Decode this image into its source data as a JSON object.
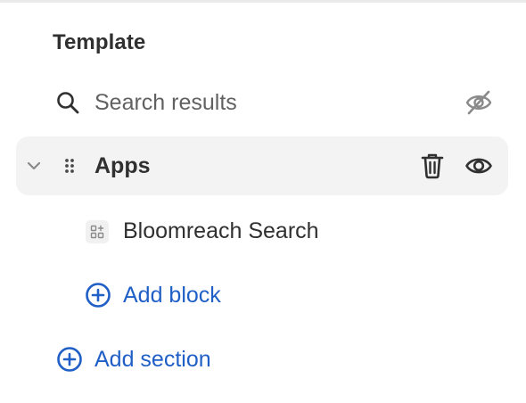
{
  "panel": {
    "heading": "Template",
    "rows": {
      "search": {
        "label": "Search results",
        "hidden": true
      },
      "apps": {
        "label": "Apps",
        "expanded": true,
        "visible": true
      },
      "bloomreach": {
        "label": "Bloomreach Search"
      },
      "add_block": {
        "label": "Add block"
      },
      "add_section": {
        "label": "Add section"
      }
    },
    "colors": {
      "accent": "#1f5fc6",
      "text": "#303030",
      "muted": "#616161",
      "row_highlight": "#f3f3f3"
    },
    "icons": {
      "search": "search-icon",
      "hidden": "eye-off-icon",
      "chevron": "chevron-down-icon",
      "drag": "drag-handle-icon",
      "delete": "trash-icon",
      "visible": "eye-icon",
      "app": "app-block-icon",
      "add": "plus-circle-icon"
    }
  }
}
